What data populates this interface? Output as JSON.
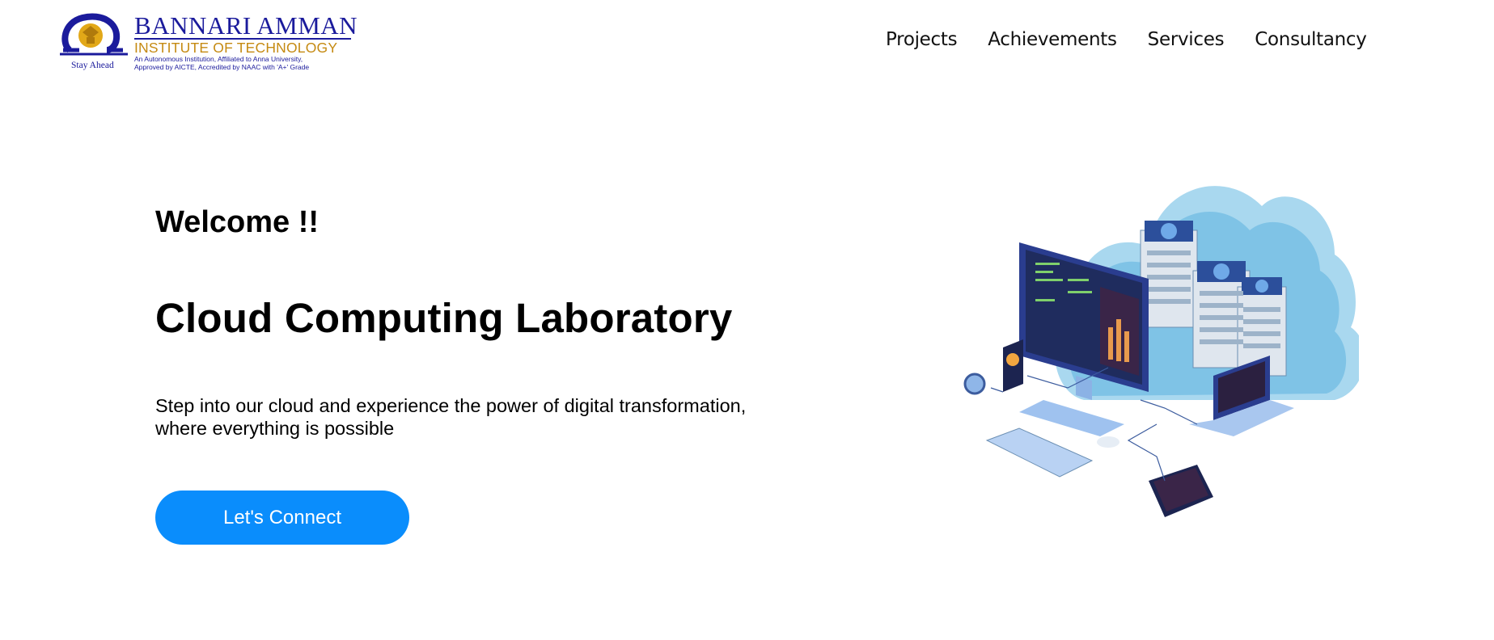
{
  "header": {
    "logo": {
      "name": "BANNARI AMMAN",
      "subtitle": "INSTITUTE OF TECHNOLOGY",
      "affiliation_line1": "An Autonomous Institution, Affiliated to Anna University,",
      "affiliation_line2": "Approved by AICTE, Accredited by NAAC with 'A+' Grade",
      "tagline": "Stay Ahead",
      "colors": {
        "primary": "#1b1b9c",
        "gold": "#c58a12"
      }
    },
    "nav": [
      {
        "label": "Projects"
      },
      {
        "label": "Achievements"
      },
      {
        "label": "Services"
      },
      {
        "label": "Consultancy"
      }
    ]
  },
  "hero": {
    "welcome": "Welcome !!",
    "title": "Cloud Computing Laboratory",
    "subtitle": "Step into our cloud and experience the power of digital transformation, where everything is possible",
    "cta_label": "Let's Connect",
    "cta_color": "#0a8dfc",
    "illustration": "cloud-computing-isometric-illustration"
  }
}
